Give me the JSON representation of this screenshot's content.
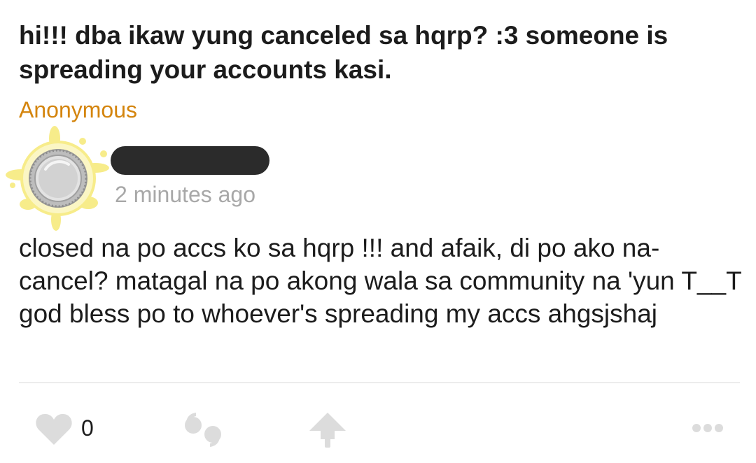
{
  "question": {
    "text": "hi!!! dba ikaw yung canceled sa hqrp? :3 someone is spreading your accounts kasi.",
    "asker": "Anonymous"
  },
  "answer": {
    "timestamp": "2 minutes ago",
    "text": "closed na po accs ko sa hqrp !!! and afaik, di po ako na-cancel? matagal na po akong wala sa community na 'yun T__T god bless po to whoever's spreading my accs ahgsjshaj"
  },
  "actions": {
    "like_count": "0",
    "icons": [
      "heart-icon",
      "quote-icon",
      "share-arrow-icon",
      "more-dots-icon"
    ]
  },
  "colors": {
    "asker": "#d4850e",
    "timestamp": "#a8a8a8",
    "icons": "#dcdcdc",
    "redaction": "#2b2b2b"
  }
}
